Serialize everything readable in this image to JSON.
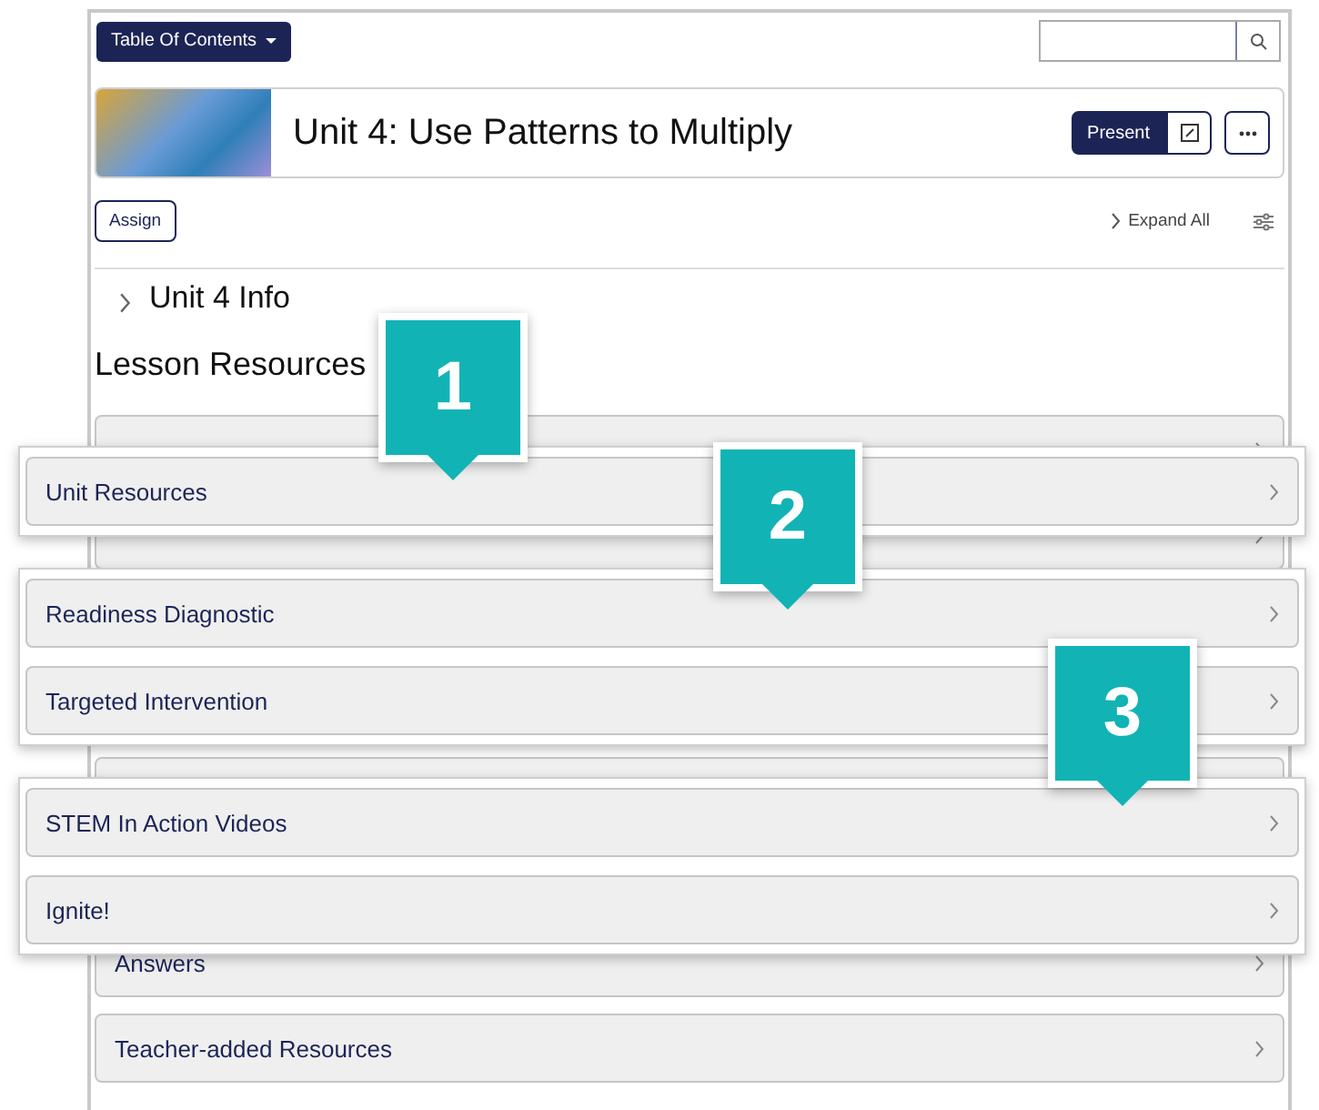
{
  "toolbar": {
    "menu_button": "Table Of Contents"
  },
  "unit_header": {
    "title": "Unit 4: Use Patterns to Multiply",
    "present_button": "Present"
  },
  "actions": {
    "assign_button": "Assign",
    "expand_all": "Expand All"
  },
  "unit_info": {
    "title": "Unit 4 Info",
    "expanded": false
  },
  "lesson_resources": {
    "heading": "Lesson Resources",
    "rows": [
      {
        "label": "Answers"
      },
      {
        "label": "Teacher-added Resources"
      }
    ]
  },
  "callout_panels": [
    {
      "number": "1",
      "rows": [
        {
          "label": "Unit Resources"
        }
      ]
    },
    {
      "number": "2",
      "rows": [
        {
          "label": "Readiness Diagnostic"
        },
        {
          "label": "Targeted Intervention"
        }
      ]
    },
    {
      "number": "3",
      "rows": [
        {
          "label": "STEM In Action Videos"
        },
        {
          "label": "Ignite!"
        }
      ]
    }
  ]
}
